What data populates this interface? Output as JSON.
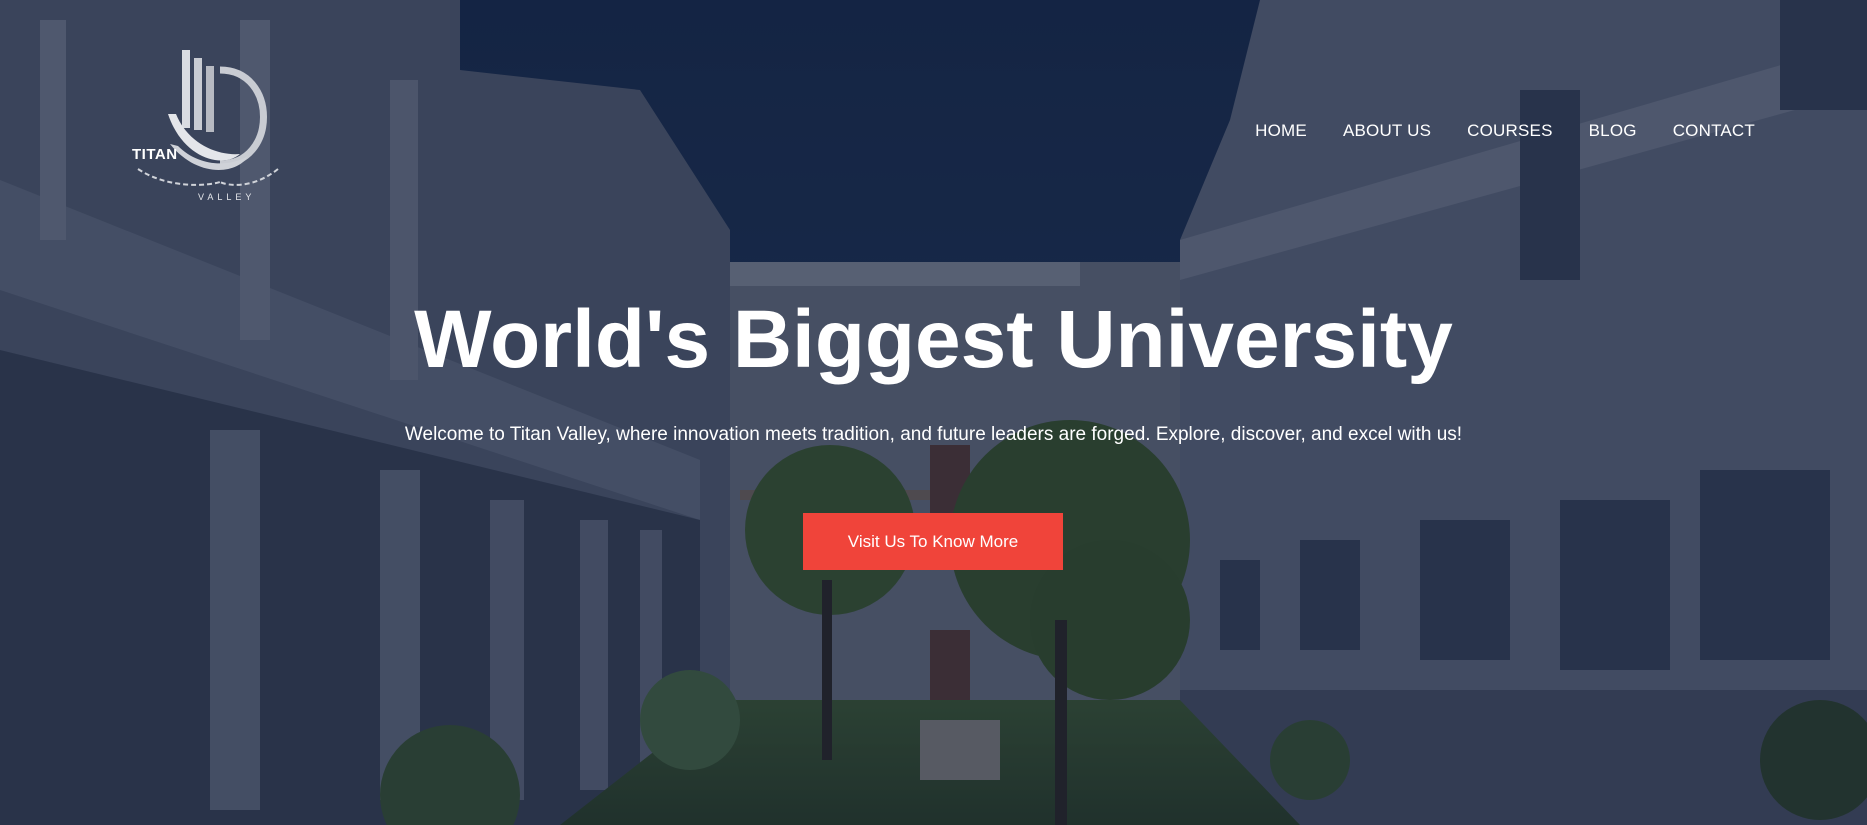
{
  "brand": {
    "name": "TITAN",
    "sub": "VALLEY",
    "icon": "titan-valley-logo"
  },
  "nav": {
    "items": [
      {
        "label": "HOME"
      },
      {
        "label": "ABOUT US"
      },
      {
        "label": "COURSES"
      },
      {
        "label": "BLOG"
      },
      {
        "label": "CONTACT"
      }
    ]
  },
  "hero": {
    "title": "World's Biggest University",
    "subtitle": "Welcome to Titan Valley, where innovation meets tradition, and future leaders are forged. Explore, discover, and excel with us!",
    "cta_label": "Visit Us To Know More"
  },
  "colors": {
    "accent": "#f0443a",
    "overlay": "#1c2b45",
    "text": "#ffffff"
  }
}
